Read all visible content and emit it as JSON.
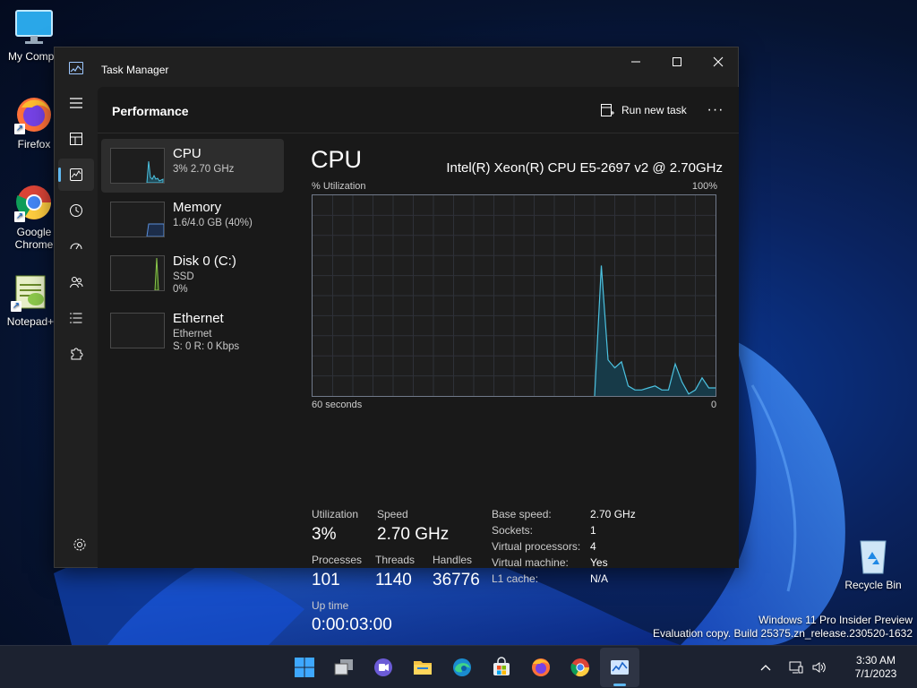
{
  "desktop": {
    "icons": [
      {
        "label": "My Compu"
      },
      {
        "label": "Firefox"
      },
      {
        "label": "Google Chrome"
      },
      {
        "label": "Notepad+"
      },
      {
        "label": "Recycle Bin"
      }
    ],
    "watermark": {
      "line1": "Windows 11 Pro Insider Preview",
      "line2": "Evaluation copy. Build 25375.zn_release.230520-1632"
    }
  },
  "window": {
    "title": "Task Manager",
    "controls": {
      "minimize": "—",
      "maximize": "☐",
      "close": "✕"
    }
  },
  "page": {
    "title": "Performance",
    "run_new_task": "Run new task",
    "more": "···"
  },
  "nav": {
    "items": [
      {
        "name": "hamburger-menu-icon"
      },
      {
        "name": "processes-icon"
      },
      {
        "name": "performance-icon",
        "active": true
      },
      {
        "name": "app-history-icon"
      },
      {
        "name": "startup-apps-icon"
      },
      {
        "name": "users-icon"
      },
      {
        "name": "details-icon"
      },
      {
        "name": "services-icon"
      }
    ],
    "settings": "settings-icon"
  },
  "resources": [
    {
      "name": "CPU",
      "sub1": "3% 2.70 GHz",
      "selected": true,
      "color": "#4cc2e0"
    },
    {
      "name": "Memory",
      "sub1": "1.6/4.0 GB (40%)",
      "color": "#5a8ed8"
    },
    {
      "name": "Disk 0 (C:)",
      "sub1": "SSD",
      "sub2": "0%",
      "color": "#8cc84b"
    },
    {
      "name": "Ethernet",
      "sub1": "Ethernet",
      "sub2": "S: 0 R: 0 Kbps",
      "color": "#c7852d"
    }
  ],
  "cpu": {
    "title": "CPU",
    "model": "Intel(R) Xeon(R) CPU E5-2697 v2 @ 2.70GHz",
    "graph_label": "% Utilization",
    "graph_max": "100%",
    "time_span": "60 seconds",
    "time_end": "0",
    "graph_series": [
      0,
      0,
      0,
      0,
      0,
      0,
      0,
      0,
      0,
      0,
      0,
      0,
      0,
      0,
      0,
      0,
      0,
      0,
      0,
      0,
      0,
      0,
      0,
      0,
      0,
      0,
      0,
      0,
      0,
      0,
      0,
      0,
      0,
      0,
      0,
      0,
      0,
      0,
      0,
      0,
      0,
      0,
      0,
      65,
      18,
      14,
      17,
      5,
      3,
      3,
      4,
      5,
      3,
      3,
      16,
      7,
      1,
      3,
      9,
      4,
      4
    ],
    "stats": {
      "utilization_label": "Utilization",
      "utilization": "3%",
      "speed_label": "Speed",
      "speed": "2.70 GHz",
      "processes_label": "Processes",
      "processes": "101",
      "threads_label": "Threads",
      "threads": "1140",
      "handles_label": "Handles",
      "handles": "36776",
      "uptime_label": "Up time",
      "uptime": "0:00:03:00"
    },
    "specs": [
      {
        "key": "Base speed:",
        "value": "2.70 GHz"
      },
      {
        "key": "Sockets:",
        "value": "1"
      },
      {
        "key": "Virtual processors:",
        "value": "4"
      },
      {
        "key": "Virtual machine:",
        "value": "Yes"
      },
      {
        "key": "L1 cache:",
        "value": "N/A"
      }
    ]
  },
  "taskbar": {
    "apps": [
      "start-icon",
      "task-view-icon",
      "chat-icon",
      "file-explorer-icon",
      "edge-icon",
      "store-icon",
      "firefox-icon",
      "chrome-icon",
      "task-manager-icon"
    ],
    "active_app": "task-manager-icon",
    "time": "3:30 AM",
    "date": "7/1/2023"
  },
  "colors": {
    "accent": "#60b8f0",
    "cpu_line": "#4cc2e0",
    "window_bg": "#202020"
  }
}
